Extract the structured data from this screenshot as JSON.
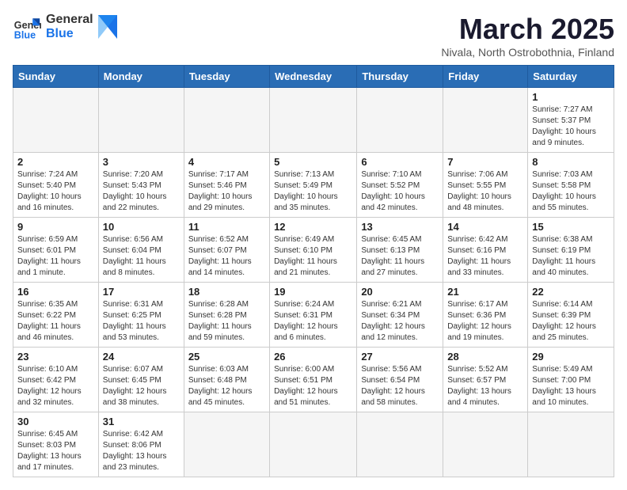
{
  "header": {
    "logo_general": "General",
    "logo_blue": "Blue",
    "title": "March 2025",
    "subtitle": "Nivala, North Ostrobothnia, Finland"
  },
  "weekdays": [
    "Sunday",
    "Monday",
    "Tuesday",
    "Wednesday",
    "Thursday",
    "Friday",
    "Saturday"
  ],
  "weeks": [
    [
      {
        "day": "",
        "info": ""
      },
      {
        "day": "",
        "info": ""
      },
      {
        "day": "",
        "info": ""
      },
      {
        "day": "",
        "info": ""
      },
      {
        "day": "",
        "info": ""
      },
      {
        "day": "",
        "info": ""
      },
      {
        "day": "1",
        "info": "Sunrise: 7:27 AM\nSunset: 5:37 PM\nDaylight: 10 hours and 9 minutes."
      }
    ],
    [
      {
        "day": "2",
        "info": "Sunrise: 7:24 AM\nSunset: 5:40 PM\nDaylight: 10 hours and 16 minutes."
      },
      {
        "day": "3",
        "info": "Sunrise: 7:20 AM\nSunset: 5:43 PM\nDaylight: 10 hours and 22 minutes."
      },
      {
        "day": "4",
        "info": "Sunrise: 7:17 AM\nSunset: 5:46 PM\nDaylight: 10 hours and 29 minutes."
      },
      {
        "day": "5",
        "info": "Sunrise: 7:13 AM\nSunset: 5:49 PM\nDaylight: 10 hours and 35 minutes."
      },
      {
        "day": "6",
        "info": "Sunrise: 7:10 AM\nSunset: 5:52 PM\nDaylight: 10 hours and 42 minutes."
      },
      {
        "day": "7",
        "info": "Sunrise: 7:06 AM\nSunset: 5:55 PM\nDaylight: 10 hours and 48 minutes."
      },
      {
        "day": "8",
        "info": "Sunrise: 7:03 AM\nSunset: 5:58 PM\nDaylight: 10 hours and 55 minutes."
      }
    ],
    [
      {
        "day": "9",
        "info": "Sunrise: 6:59 AM\nSunset: 6:01 PM\nDaylight: 11 hours and 1 minute."
      },
      {
        "day": "10",
        "info": "Sunrise: 6:56 AM\nSunset: 6:04 PM\nDaylight: 11 hours and 8 minutes."
      },
      {
        "day": "11",
        "info": "Sunrise: 6:52 AM\nSunset: 6:07 PM\nDaylight: 11 hours and 14 minutes."
      },
      {
        "day": "12",
        "info": "Sunrise: 6:49 AM\nSunset: 6:10 PM\nDaylight: 11 hours and 21 minutes."
      },
      {
        "day": "13",
        "info": "Sunrise: 6:45 AM\nSunset: 6:13 PM\nDaylight: 11 hours and 27 minutes."
      },
      {
        "day": "14",
        "info": "Sunrise: 6:42 AM\nSunset: 6:16 PM\nDaylight: 11 hours and 33 minutes."
      },
      {
        "day": "15",
        "info": "Sunrise: 6:38 AM\nSunset: 6:19 PM\nDaylight: 11 hours and 40 minutes."
      }
    ],
    [
      {
        "day": "16",
        "info": "Sunrise: 6:35 AM\nSunset: 6:22 PM\nDaylight: 11 hours and 46 minutes."
      },
      {
        "day": "17",
        "info": "Sunrise: 6:31 AM\nSunset: 6:25 PM\nDaylight: 11 hours and 53 minutes."
      },
      {
        "day": "18",
        "info": "Sunrise: 6:28 AM\nSunset: 6:28 PM\nDaylight: 11 hours and 59 minutes."
      },
      {
        "day": "19",
        "info": "Sunrise: 6:24 AM\nSunset: 6:31 PM\nDaylight: 12 hours and 6 minutes."
      },
      {
        "day": "20",
        "info": "Sunrise: 6:21 AM\nSunset: 6:34 PM\nDaylight: 12 hours and 12 minutes."
      },
      {
        "day": "21",
        "info": "Sunrise: 6:17 AM\nSunset: 6:36 PM\nDaylight: 12 hours and 19 minutes."
      },
      {
        "day": "22",
        "info": "Sunrise: 6:14 AM\nSunset: 6:39 PM\nDaylight: 12 hours and 25 minutes."
      }
    ],
    [
      {
        "day": "23",
        "info": "Sunrise: 6:10 AM\nSunset: 6:42 PM\nDaylight: 12 hours and 32 minutes."
      },
      {
        "day": "24",
        "info": "Sunrise: 6:07 AM\nSunset: 6:45 PM\nDaylight: 12 hours and 38 minutes."
      },
      {
        "day": "25",
        "info": "Sunrise: 6:03 AM\nSunset: 6:48 PM\nDaylight: 12 hours and 45 minutes."
      },
      {
        "day": "26",
        "info": "Sunrise: 6:00 AM\nSunset: 6:51 PM\nDaylight: 12 hours and 51 minutes."
      },
      {
        "day": "27",
        "info": "Sunrise: 5:56 AM\nSunset: 6:54 PM\nDaylight: 12 hours and 58 minutes."
      },
      {
        "day": "28",
        "info": "Sunrise: 5:52 AM\nSunset: 6:57 PM\nDaylight: 13 hours and 4 minutes."
      },
      {
        "day": "29",
        "info": "Sunrise: 5:49 AM\nSunset: 7:00 PM\nDaylight: 13 hours and 10 minutes."
      }
    ],
    [
      {
        "day": "30",
        "info": "Sunrise: 6:45 AM\nSunset: 8:03 PM\nDaylight: 13 hours and 17 minutes."
      },
      {
        "day": "31",
        "info": "Sunrise: 6:42 AM\nSunset: 8:06 PM\nDaylight: 13 hours and 23 minutes."
      },
      {
        "day": "",
        "info": ""
      },
      {
        "day": "",
        "info": ""
      },
      {
        "day": "",
        "info": ""
      },
      {
        "day": "",
        "info": ""
      },
      {
        "day": "",
        "info": ""
      }
    ]
  ]
}
